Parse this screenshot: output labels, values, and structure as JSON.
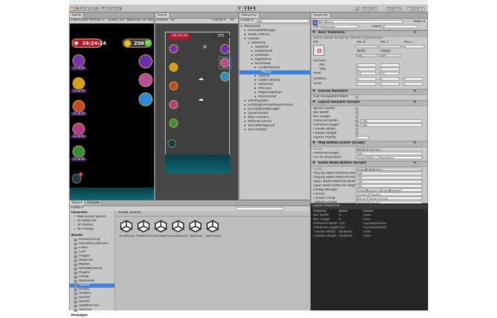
{
  "menubar": {
    "items": [
      "File",
      "Edit",
      "Assets",
      "GameObject",
      "Component",
      "GameTrack",
      "Mail",
      "Tools",
      "Window",
      "Help"
    ]
  },
  "toolbar": {
    "play_icon": "▶",
    "pause_icon": "❚❚",
    "step_icon": "▶❚",
    "cloud_label": "☁",
    "account_label": "Account ▾",
    "layers_label": "Layers ▾",
    "layout_label": "Layout ▾",
    "pivot_label": "Pivot",
    "global_label": "Global"
  },
  "game_panel": {
    "tab_label": "Game",
    "resolution": "1080x1920 Portrait (1080x1920)",
    "scale_label": "Scale",
    "scale_value": "0.32x",
    "maximize_label": "Maximize On Play",
    "timer": "24:24:24",
    "coins": "250",
    "plus": "+",
    "item_timers": [
      "14:28:00",
      "14:28:00",
      "14:28:00",
      "14:28:00",
      "14:28:00"
    ],
    "badge": "1"
  },
  "scene_panel": {
    "tab_label": "Scene",
    "shaded_label": "Shaded",
    "mode_2d": "2D",
    "gizmos_label": "Gizmos ▾",
    "all_label": "All",
    "timer": "24:24:24",
    "coins": "250"
  },
  "hierarchy_panel": {
    "tab_label": "Hierarchy",
    "create_label": "Create ▾",
    "search_placeholder": "All",
    "items": [
      {
        "label": "MapScene",
        "indent": 0
      },
      {
        "label": "UserDataManager",
        "indent": 1
      },
      {
        "label": "Audio Listener",
        "indent": 1
      },
      {
        "label": "Canvas",
        "indent": 1
      },
      {
        "label": "SafeArea",
        "indent": 2
      },
      {
        "label": "TopPanel",
        "indent": 3
      },
      {
        "label": "SideBarLeft",
        "indent": 3
      },
      {
        "label": "LeftPanel",
        "indent": 3
      },
      {
        "label": "RightPanel",
        "indent": 3
      },
      {
        "label": "ScrollView",
        "indent": 3
      },
      {
        "label": "ContentBoard",
        "indent": 4
      },
      {
        "label": "Popup",
        "indent": 5
      },
      {
        "label": "Tutorial",
        "indent": 4
      },
      {
        "label": "Global Display",
        "indent": 4
      },
      {
        "label": "SlotDecor",
        "indent": 4
      },
      {
        "label": "Previous",
        "indent": 4
      },
      {
        "label": "PreparingPanel",
        "indent": 4
      },
      {
        "label": "PhysicsLeaf",
        "indent": 4
      },
      {
        "label": "EventSystem",
        "indent": 1
      },
      {
        "label": "LoadingOverlayPopupCanvas",
        "indent": 1
      },
      {
        "label": "LocalizationManager",
        "indent": 1
      },
      {
        "label": "InputChecker",
        "indent": 1
      },
      {
        "label": "Main Camera",
        "indent": 1
      },
      {
        "label": "ParticleCamera",
        "indent": 1
      },
      {
        "label": "TouchManager2D",
        "indent": 1
      },
      {
        "label": "AdController",
        "indent": 1
      }
    ],
    "selected_index": 11
  },
  "inspector": {
    "tab_label": "Inspector",
    "object_name": "Popup",
    "static_label": "Static ▾",
    "tag_label": "Tag",
    "tag_value": "Untagged",
    "layer_label": "Layer",
    "layer_value": "UI",
    "rect_transform": {
      "title": "Rect Transform",
      "note": "Some values driven by Vertical LayoutGroup.",
      "anchor_label": "left",
      "pos_x_label": "Pos X",
      "pos_y_label": "Pos Y",
      "pos_z_label": "Pos Z",
      "pos_x": "",
      "pos_y": "",
      "pos_z": "0",
      "width_label": "Width",
      "height_label": "Height",
      "width": "140",
      "height": "140",
      "anchors_label": "Anchors",
      "min_label": "Min",
      "max_label": "Max",
      "pivot_label": "Pivot",
      "rotation_label": "Rotation",
      "scale_label": "Scale",
      "min_x": "0",
      "min_y": "1",
      "max_x": "0",
      "max_y": "1",
      "pivot_x": "0.5",
      "pivot_y": "0.5",
      "rot_x": "0",
      "rot_y": "0",
      "rot_z": "0",
      "scale_x": "1",
      "scale_y": "1",
      "scale_z": "1"
    },
    "canvas_renderer": {
      "title": "Canvas Renderer",
      "cull_label": "Cull Transparent Mesh"
    },
    "layout_element": {
      "title": "Layout Element (Script)",
      "fields": [
        "Ignore Layout",
        "Min Width",
        "Min Height",
        "Preferred Width",
        "Preferred Height",
        "Flexible Width",
        "Flexible Height",
        "Layout Priority"
      ],
      "preferred_width": "140",
      "preferred_height": "140",
      "layout_priority": "1"
    },
    "map_button_scaler": {
      "title": "Map Button Scaler (Script)",
      "script_label": "Script",
      "script_value": "MapButtonScaler",
      "pref_height_label": "Preferred Height",
      "pref_height": "140",
      "for_orientation_label": "For All Orientation",
      "for_orientation": "Aspect Ratio → Orientation"
    },
    "game_button_view": {
      "title": "Game Mode Button (Script)",
      "script_label": "Script",
      "script_value": "GameModeButton",
      "rows": [
        {
          "label": "Playing State Preferred Width",
          "value": "140"
        },
        {
          "label": "Playing State Preferred Height",
          "value": "140"
        },
        {
          "label": "Open State Preferred Width",
          "value": "140"
        },
        {
          "label": "Open State Preferred Height",
          "value": "150"
        },
        {
          "label": "Dialog Manager",
          "value": "DialogManager (DialogManager)"
        },
        {
          "label": "Canvas",
          "value": "Canvas (Canvas)"
        },
        {
          "label": "Canvas Group",
          "value": "Popup (Canvas Group)"
        },
        {
          "label": "Tutorial Canvas",
          "value": "Tutorial (Canvas)"
        },
        {
          "label": "Tutorial Canvas Group",
          "value": "Tutorial (Canvas Group)"
        },
        {
          "label": "Layout Element",
          "value": "Popup (LayoutElement)"
        },
        {
          "label": "Map Button Scaler",
          "value": "Popup (MapButtonScaler)"
        }
      ]
    }
  },
  "project_panel": {
    "tab_project": "Project",
    "tab_console": "Console",
    "create_label": "Create ▾",
    "favorites_label": "Favorites",
    "favorites": [
      "New Saved Search",
      "All Materials",
      "All Models",
      "All Prefabs"
    ],
    "assets_label": "Assets",
    "folders": [
      "AnimationClip",
      "AnimatorController",
      "Editor",
      "Font",
      "Images",
      "Materials",
      "Models",
      "MonoBehaviour",
      "Plugins",
      "Prefab",
      "Resources",
      "Scenes",
      "Scripts",
      "Shaders",
      "Sounds",
      "Sprites",
      "TextMesh Pro",
      "Textures"
    ],
    "selected_folder": "Scenes",
    "packages_label": "Packages",
    "breadcrumb": [
      "Assets",
      "Scenes"
    ],
    "scene_files": [
      "PuzzleScene",
      "PuzzleScene2",
      "GameplayScene",
      "LoadingScene",
      "MapScene",
      "SplashScene"
    ]
  },
  "layout_properties": {
    "title": "Layout Properties",
    "headers": [
      "Property",
      "Value",
      "Source"
    ],
    "rows": [
      [
        "Min Width",
        "0",
        "none"
      ],
      [
        "Min Height",
        "0",
        "none"
      ],
      [
        "Preferred Width",
        "140",
        "LayoutElement"
      ],
      [
        "Preferred Height",
        "140",
        "LayoutElement"
      ],
      [
        "Flexible Width",
        "disabled",
        "none"
      ],
      [
        "Flexible Height",
        "disabled",
        "none"
      ]
    ]
  },
  "colors": {
    "accent": "#3d80df",
    "panel": "#c2c2c2",
    "dark": "#262626",
    "teal": "#0d5861"
  }
}
